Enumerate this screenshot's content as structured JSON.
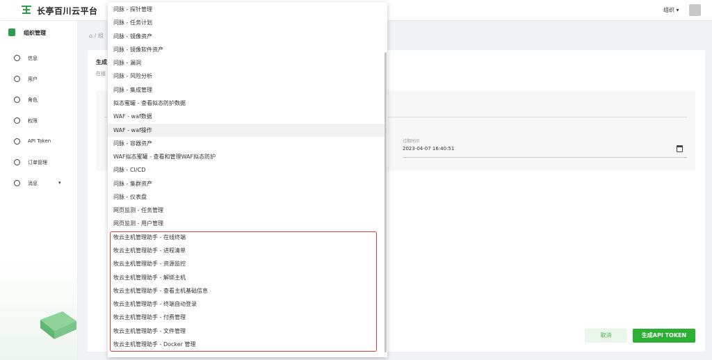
{
  "header": {
    "app_title": "长亭百川云平台",
    "org_label": "组织 ▾"
  },
  "sidebar": {
    "section_title": "组织管理",
    "items": [
      {
        "label": "信息"
      },
      {
        "label": "用户"
      },
      {
        "label": "角色"
      },
      {
        "label": "权限"
      },
      {
        "label": "API Token"
      },
      {
        "label": "订单管理"
      },
      {
        "label": "消息",
        "caret": "▾"
      }
    ]
  },
  "breadcrumb": {
    "text": "⌂ / 组"
  },
  "panel": {
    "title": "生成",
    "desc": "在组",
    "expiry_label": "过期时间",
    "expiry_value": "2023-04-07 16:40:51",
    "cancel_label": "取消",
    "generate_label": "生成API TOKEN"
  },
  "dropdown": {
    "options": [
      "问脉 - 探针管理",
      "问脉 - 任务计划",
      "问脉 - 镜像资产",
      "问脉 - 镜像软件资产",
      "问脉 - 漏洞",
      "问脉 - 风险分析",
      "问脉 - 集成管理",
      "拟态蜜罐 - 查看拟态防护数据",
      "WAF - waf数据",
      "WAF - waf操作",
      "问脉 - 容器资产",
      "WAF拟态蜜罐 - 查看和管理WAF拟态防护",
      "问脉 - CI/CD",
      "问脉 - 集群资产",
      "问脉 - 仪表盘",
      "网页监测 - 任务管理",
      "网页监测 - 用户管理",
      "牧云主机管理助手 - 在线终端",
      "牧云主机管理助手 - 进程清单",
      "牧云主机管理助手 - 资源监控",
      "牧云主机管理助手 - 解绑主机",
      "牧云主机管理助手 - 查看主机基础信息",
      "牧云主机管理助手 - 终端自动登录",
      "牧云主机管理助手 - 付费管理",
      "牧云主机管理助手 - 文件管理",
      "牧云主机管理助手 - Docker 管理"
    ],
    "highlighted_index": 9
  },
  "colors": {
    "primary": "#2bb033",
    "highlight_border": "#e53935"
  }
}
